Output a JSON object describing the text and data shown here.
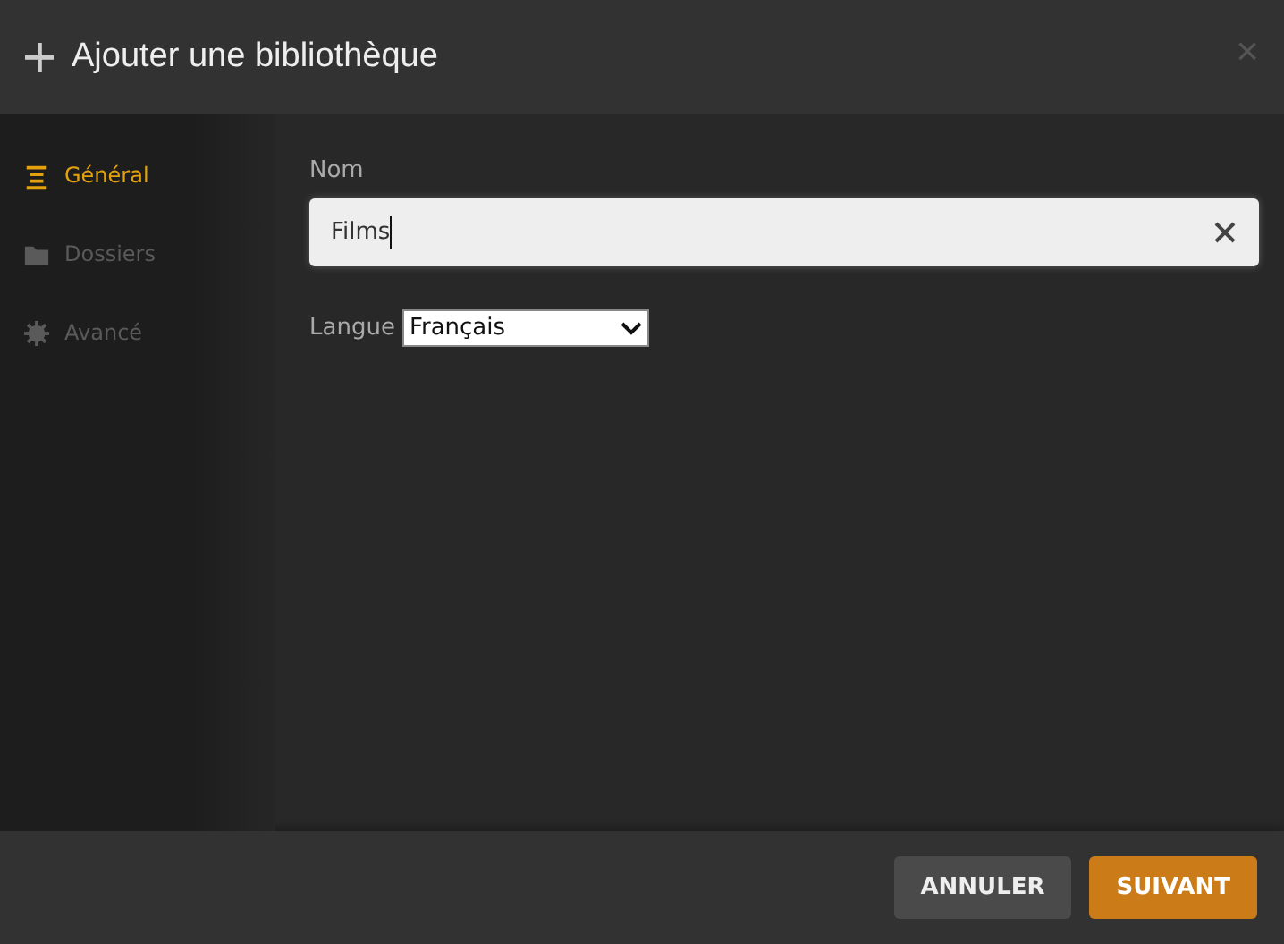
{
  "window": {
    "title": "Ajouter une bibliothèque",
    "close": "×"
  },
  "sidebar": {
    "items": [
      {
        "label": "Général",
        "kind": "list",
        "selected": true
      },
      {
        "label": "Dossiers",
        "kind": "folder",
        "selected": false
      },
      {
        "label": "Avancé",
        "kind": "gear",
        "selected": false
      }
    ]
  },
  "form": {
    "name_label": "Nom",
    "name_value": "Films",
    "language_label": "Langue",
    "language_value": "Français"
  },
  "buttons": [
    {
      "label": "ANNULER",
      "kind": "secondary"
    },
    {
      "label": "SUIVANT",
      "kind": "primary"
    }
  ]
}
